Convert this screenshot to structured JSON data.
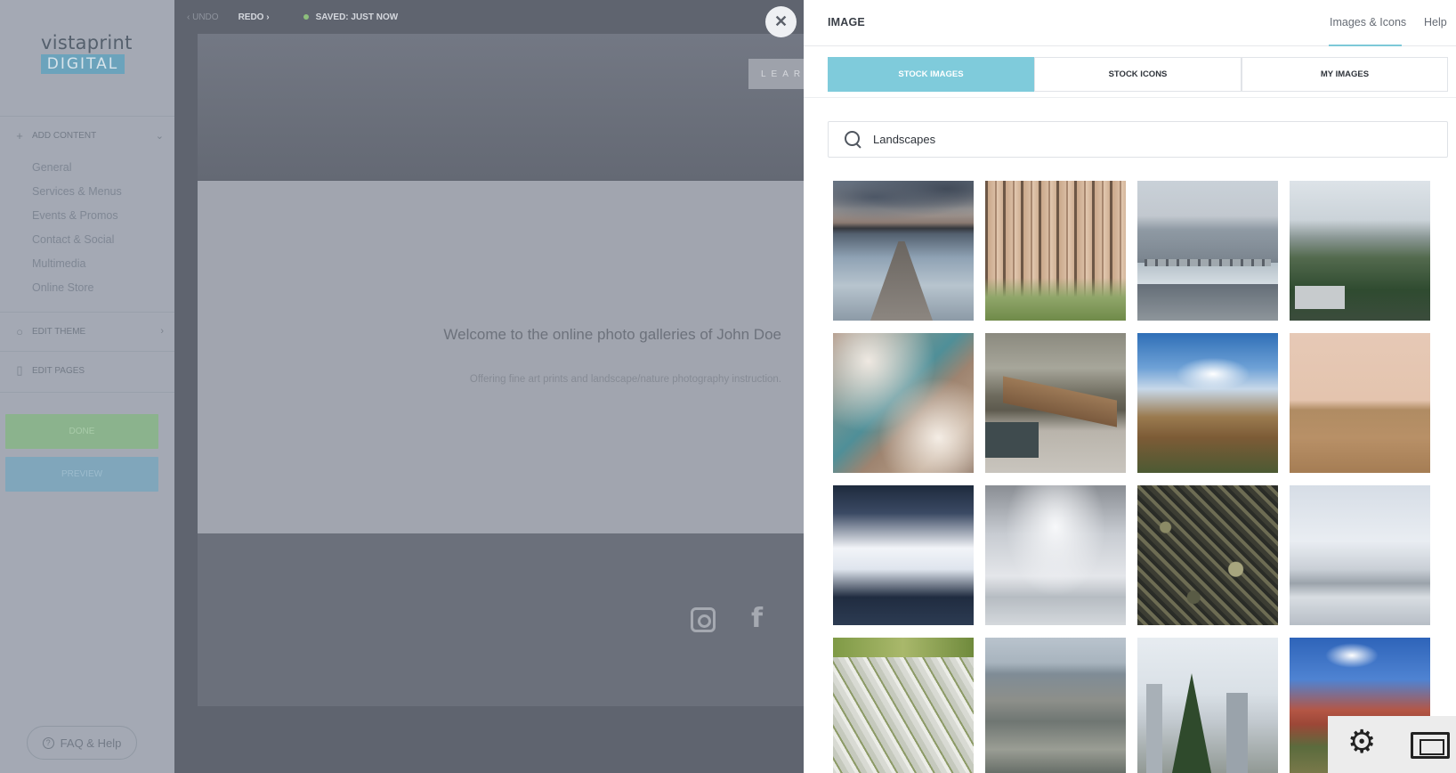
{
  "sidebar": {
    "logo_word": "vistaprint",
    "logo_sub": "DIGITAL",
    "add_content": "ADD CONTENT",
    "add_content_items": [
      "General",
      "Services & Menus",
      "Events & Promos",
      "Contact & Social",
      "Multimedia",
      "Online Store"
    ],
    "edit_theme": "EDIT THEME",
    "edit_pages": "EDIT PAGES",
    "done": "DONE",
    "preview": "PREVIEW",
    "faq": "FAQ & Help"
  },
  "editor": {
    "undo": "UNDO",
    "redo": "REDO",
    "saved": "SAVED: JUST NOW",
    "learn": "LEAR",
    "welcome": "Welcome to the online photo galleries of John Doe",
    "offering": "Offering fine art prints and landscape/nature photography instruction."
  },
  "panel": {
    "title": "IMAGE",
    "header_tabs": [
      "Images & Icons",
      "Help"
    ],
    "segments": [
      "STOCK IMAGES",
      "STOCK ICONS",
      "MY IMAGES"
    ],
    "active_segment": "STOCK IMAGES",
    "search": {
      "value": "Landscapes"
    }
  },
  "images": [
    "lake-pier-sunset",
    "forest-trees",
    "city-river-bridge",
    "green-hillside",
    "aerial-clouds-river",
    "wooden-footbridge",
    "blue-sky-hillside",
    "desert-plain",
    "snowy-valley",
    "cloudy-sky-fence",
    "mossy-ground",
    "snowy-field",
    "white-fronds",
    "city-aerial-view",
    "city-tower-trees",
    "red-mountain"
  ],
  "colors": {
    "accent": "#7fcbdb",
    "done_green": "#8bb38d",
    "preview_blue": "#80a6bb"
  }
}
